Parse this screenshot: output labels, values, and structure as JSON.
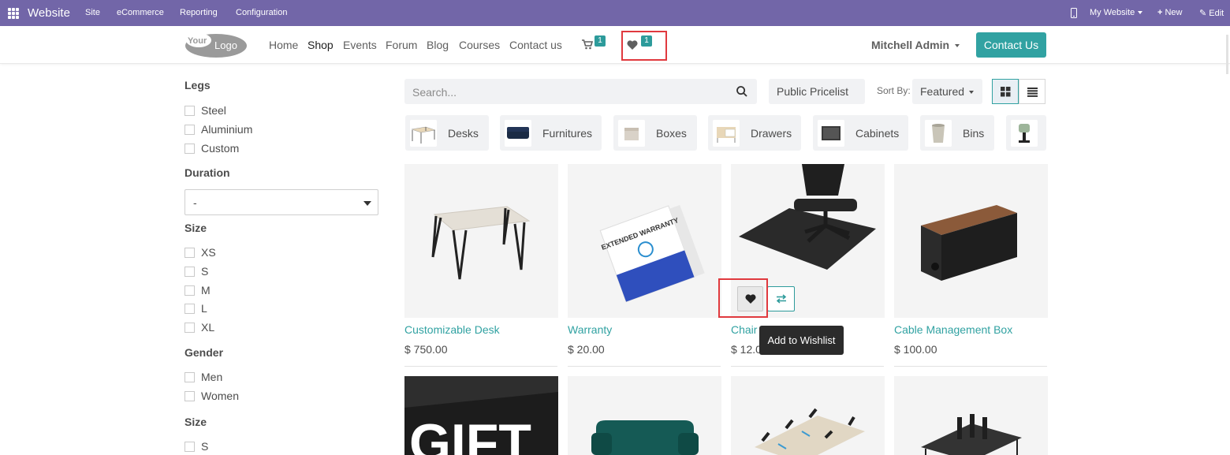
{
  "topbar": {
    "brand": "Website",
    "menu": [
      "Site",
      "eCommerce",
      "Reporting",
      "Configuration"
    ],
    "website_switch": "My Website",
    "new_label": "New",
    "edit_label": "Edit",
    "bg_color": "#7266a8"
  },
  "navbar": {
    "logo_text": "YourLogo",
    "links": [
      "Home",
      "Shop",
      "Events",
      "Forum",
      "Blog",
      "Courses",
      "Contact us"
    ],
    "active_link": "Shop",
    "cart_count": "1",
    "wishlist_count": "1",
    "user": "Mitchell Admin",
    "contact_button": "Contact Us",
    "accent_color": "#31a2a2"
  },
  "filters": {
    "legs": {
      "title": "Legs",
      "options": [
        "Steel",
        "Aluminium",
        "Custom"
      ]
    },
    "duration": {
      "title": "Duration",
      "value": "-"
    },
    "size": {
      "title": "Size",
      "options": [
        "XS",
        "S",
        "M",
        "L",
        "XL"
      ]
    },
    "gender": {
      "title": "Gender",
      "options": [
        "Men",
        "Women"
      ]
    },
    "size2": {
      "title": "Size",
      "options": [
        "S"
      ]
    }
  },
  "toolbar": {
    "search_placeholder": "Search...",
    "pricelist": "Public Pricelist",
    "sort_label": "Sort By:",
    "sort_value": "Featured"
  },
  "categories": [
    "Desks",
    "Furnitures",
    "Boxes",
    "Drawers",
    "Cabinets",
    "Bins"
  ],
  "products": [
    {
      "name": "Customizable Desk",
      "price": "$ 750.00"
    },
    {
      "name": "Warranty",
      "price": "$ 20.00"
    },
    {
      "name": "Chair floor protection",
      "price": "$ 12.00"
    },
    {
      "name": "Cable Management Box",
      "price": "$ 100.00"
    }
  ],
  "warranty_box_text": "EXTENDED WARRANTY",
  "gift_text": "GIFT",
  "tooltip": "Add to Wishlist",
  "icons": [
    "apps-icon",
    "mobile-icon",
    "plus-icon",
    "pencil-icon",
    "cart-icon",
    "heart-icon",
    "search-icon",
    "grid-view-icon",
    "list-view-icon",
    "compare-icon"
  ]
}
